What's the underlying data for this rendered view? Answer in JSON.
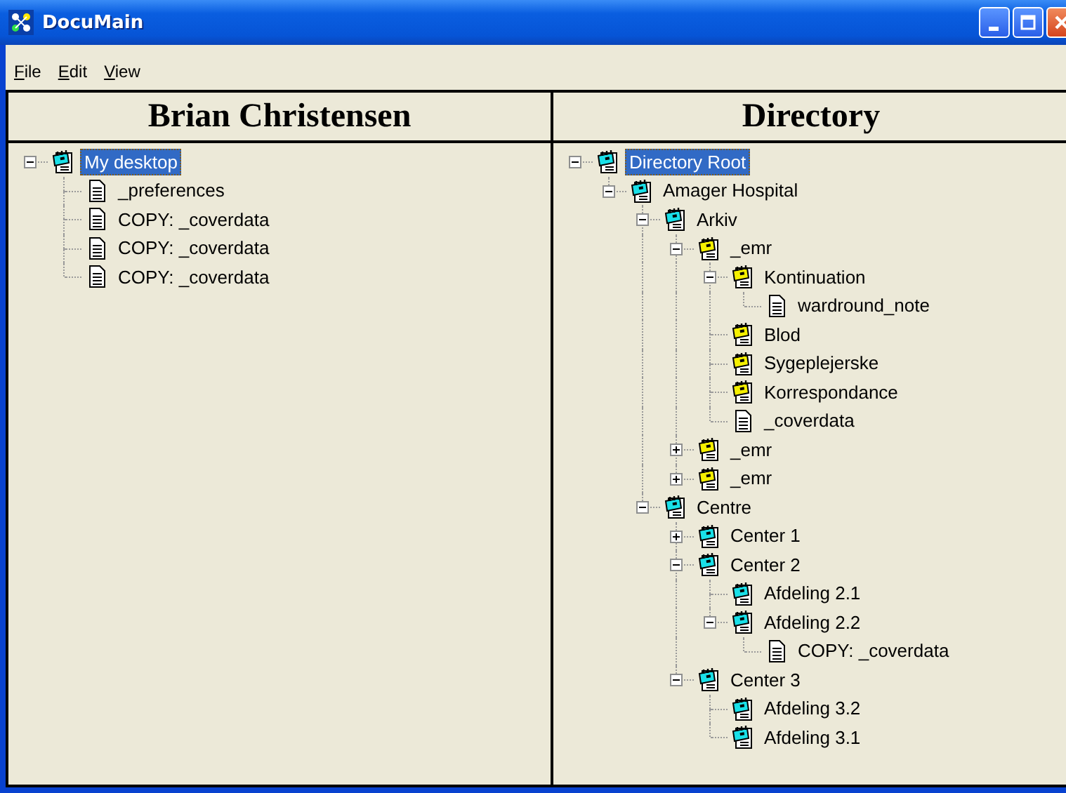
{
  "window": {
    "title": "DocuMain"
  },
  "menu": [
    {
      "label": "File"
    },
    {
      "label": "Edit"
    },
    {
      "label": "View"
    }
  ],
  "panels": [
    {
      "heading": "Brian Christensen",
      "tree": [
        {
          "label": "My desktop",
          "kind": "folder",
          "color": "#19e0e8",
          "expanded": true,
          "selected": true,
          "children": [
            {
              "label": "_preferences",
              "kind": "doc",
              "selected": false
            },
            {
              "label": "COPY: _coverdata",
              "kind": "doc",
              "selected": false
            },
            {
              "label": "COPY: _coverdata",
              "kind": "doc",
              "selected": false
            },
            {
              "label": "COPY: _coverdata",
              "kind": "doc",
              "selected": false
            }
          ]
        }
      ]
    },
    {
      "heading": "Directory",
      "tree": [
        {
          "label": "Directory Root",
          "kind": "folder",
          "color": "#19e0e8",
          "expanded": true,
          "selected": true,
          "children": [
            {
              "label": "Amager Hospital",
              "kind": "folder",
              "color": "#19e0e8",
              "expanded": true,
              "selected": false,
              "children": [
                {
                  "label": "Arkiv",
                  "kind": "folder",
                  "color": "#19e0e8",
                  "expanded": true,
                  "selected": false,
                  "children": [
                    {
                      "label": "_emr",
                      "kind": "folder",
                      "color": "#f5f000",
                      "expanded": true,
                      "selected": false,
                      "children": [
                        {
                          "label": "Kontinuation",
                          "kind": "folder",
                          "color": "#f5f000",
                          "expanded": true,
                          "selected": false,
                          "children": [
                            {
                              "label": "wardround_note",
                              "kind": "doc",
                              "selected": false
                            }
                          ]
                        },
                        {
                          "label": "Blod",
                          "kind": "folder",
                          "color": "#f5f000",
                          "selected": false
                        },
                        {
                          "label": "Sygeplejerske",
                          "kind": "folder",
                          "color": "#f5f000",
                          "selected": false
                        },
                        {
                          "label": "Korrespondance",
                          "kind": "folder",
                          "color": "#f5f000",
                          "selected": false
                        },
                        {
                          "label": "_coverdata",
                          "kind": "doc",
                          "selected": false
                        }
                      ]
                    },
                    {
                      "label": "_emr",
                      "kind": "folder",
                      "color": "#f5f000",
                      "expanded": false,
                      "selected": false
                    },
                    {
                      "label": "_emr",
                      "kind": "folder",
                      "color": "#f5f000",
                      "expanded": false,
                      "selected": false
                    }
                  ]
                },
                {
                  "label": "Centre",
                  "kind": "folder",
                  "color": "#19e0e8",
                  "expanded": true,
                  "selected": false,
                  "children": [
                    {
                      "label": "Center 1",
                      "kind": "folder",
                      "color": "#19e0e8",
                      "expanded": false,
                      "selected": false
                    },
                    {
                      "label": "Center 2",
                      "kind": "folder",
                      "color": "#19e0e8",
                      "expanded": true,
                      "selected": false,
                      "children": [
                        {
                          "label": "Afdeling 2.1",
                          "kind": "folder",
                          "color": "#19e0e8",
                          "selected": false
                        },
                        {
                          "label": "Afdeling 2.2",
                          "kind": "folder",
                          "color": "#19e0e8",
                          "expanded": true,
                          "selected": false,
                          "children": [
                            {
                              "label": "COPY: _coverdata",
                              "kind": "doc",
                              "selected": false
                            }
                          ]
                        }
                      ]
                    },
                    {
                      "label": "Center 3",
                      "kind": "folder",
                      "color": "#19e0e8",
                      "expanded": true,
                      "selected": false,
                      "children": [
                        {
                          "label": "Afdeling 3.2",
                          "kind": "folder",
                          "color": "#19e0e8",
                          "selected": false
                        },
                        {
                          "label": "Afdeling 3.1",
                          "kind": "folder",
                          "color": "#19e0e8",
                          "selected": false
                        }
                      ]
                    }
                  ]
                }
              ]
            }
          ]
        }
      ]
    }
  ]
}
